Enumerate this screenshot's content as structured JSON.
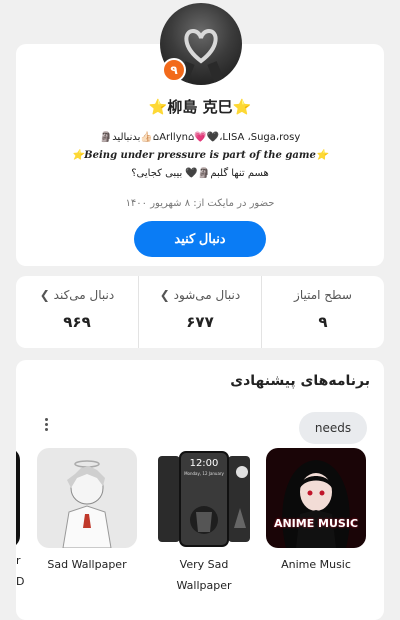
{
  "profile": {
    "level": "۹",
    "display_name": "⭐柳島 克巳⭐",
    "bio_line1": "🗿بدنبالید👍🏻⌂Arllyn⌂💗🖤،LISA ،Suga،rosy",
    "bio_line2": "⭐Being under pressure is part of the game⭐",
    "bio_line3": "هسم تنها گلبم🗿🖤 بیبی کجایی؟",
    "joined": "حضور در مایکت از: ۸ شهریور ۱۴۰۰",
    "follow_button": "دنبال کنید"
  },
  "stats": [
    {
      "label": "سطح امتیاز",
      "value": "۹"
    },
    {
      "label": "دنبال می‌شود",
      "value": "۶۷۷"
    },
    {
      "label": "دنبال می‌کند",
      "value": "۹۶۹"
    }
  ],
  "suggested": {
    "title": "برنامه‌های پیشنهادی",
    "tag": "needs",
    "apps": [
      {
        "name": "Anime Music",
        "icon_text": "ANIME MUSIC"
      },
      {
        "name": "Very Sad Wallpaper",
        "lockscreen_time": "12:00",
        "lockscreen_date": "Monday, 12 January"
      },
      {
        "name": "Sad Wallpaper"
      }
    ],
    "edge_letters": [
      "r",
      "D"
    ]
  },
  "colors": {
    "accent": "#0a7cf5",
    "badge": "#f26a1b"
  }
}
